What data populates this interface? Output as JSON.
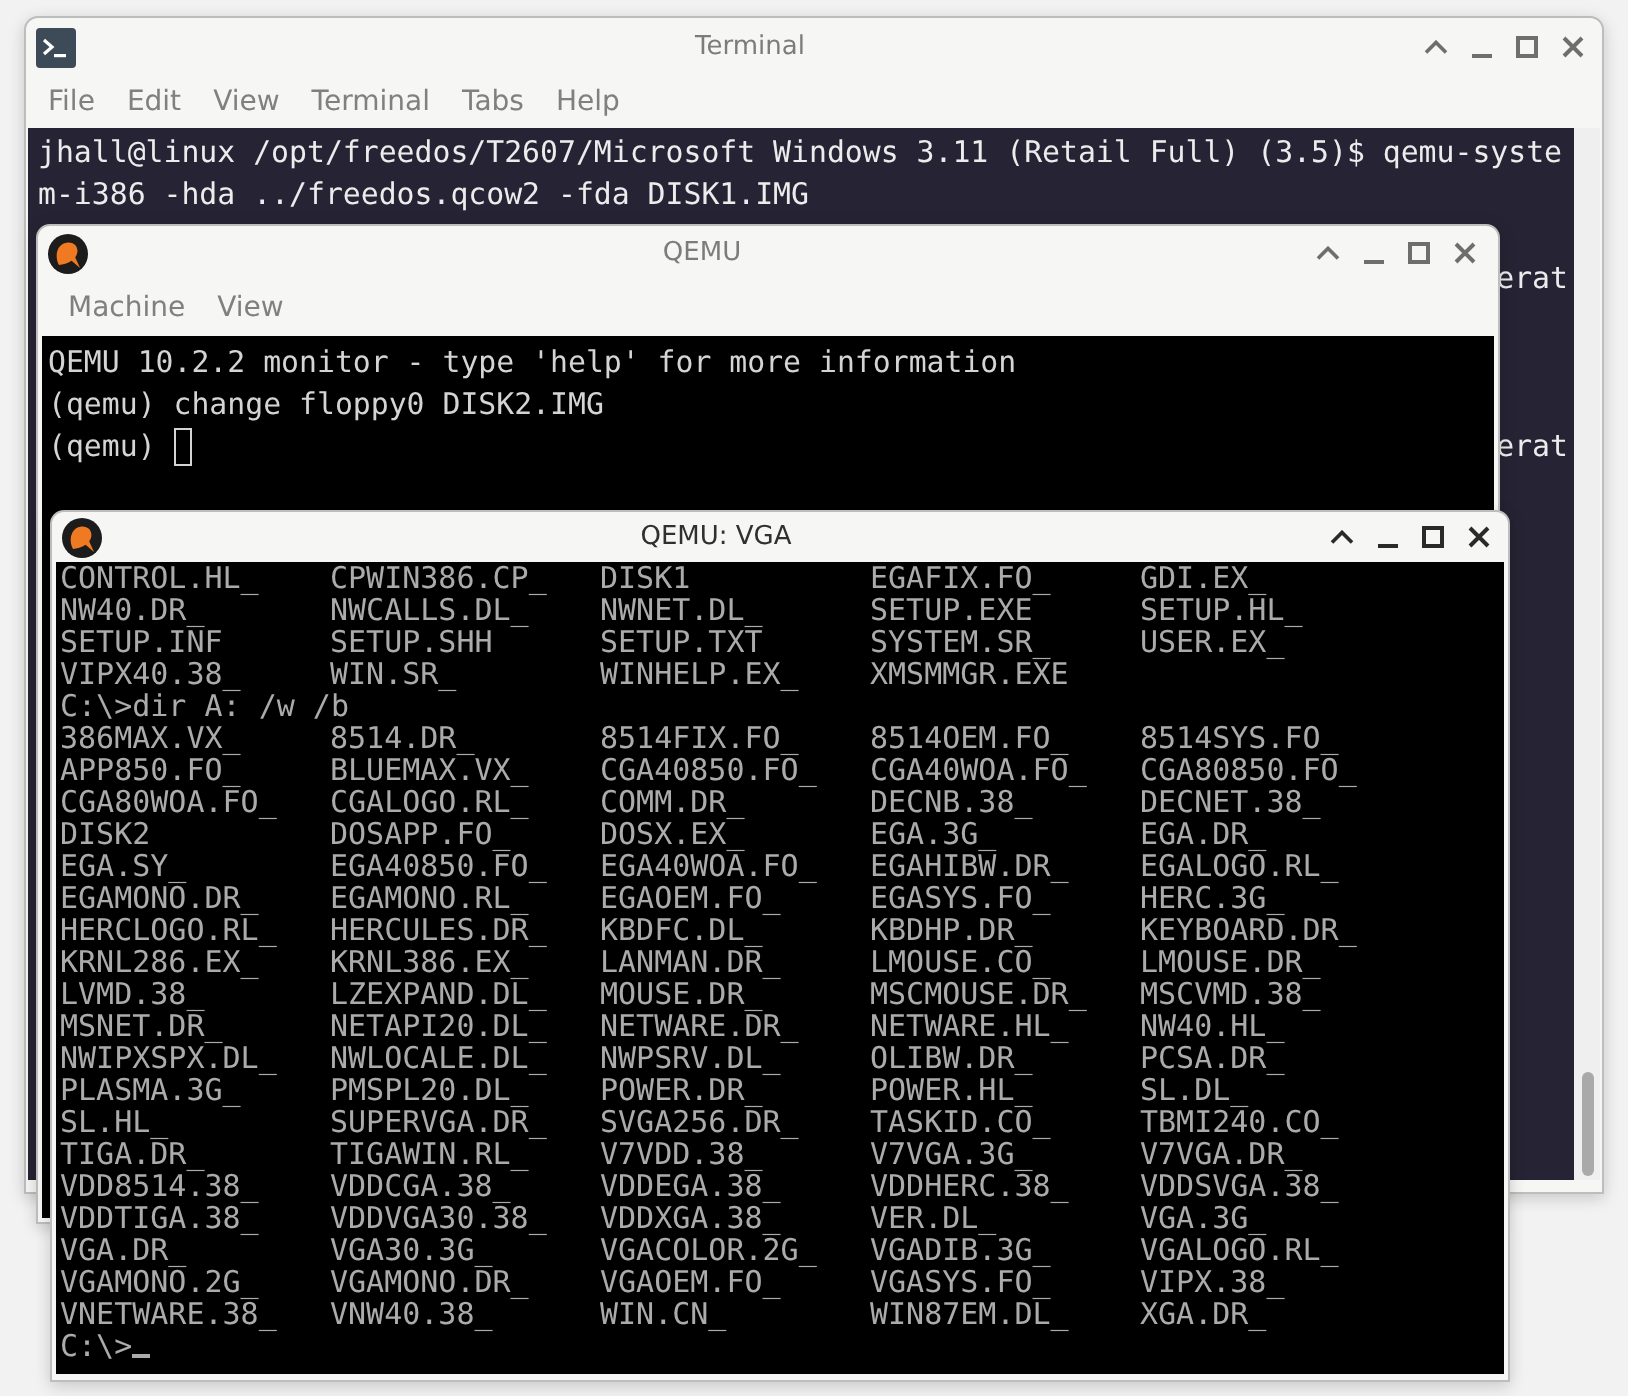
{
  "terminal": {
    "title": "Terminal",
    "active": false,
    "menu": [
      "File",
      "Edit",
      "View",
      "Terminal",
      "Tabs",
      "Help"
    ],
    "lines": [
      {
        "kind": "full",
        "text": "jhall@linux /opt/freedos/T2607/Microsoft Windows 3.11 (Retail Full) (3.5)$ qemu-syste"
      },
      {
        "kind": "full",
        "text": "m-i386 -hda ../freedos.qcow2 -fda DISK1.IMG"
      },
      {
        "kind": "cut",
        "text": "erat"
      },
      {
        "kind": "cut",
        "text": "erat"
      }
    ]
  },
  "monitor": {
    "title": "QEMU",
    "active": false,
    "menu": [
      "Machine",
      "View"
    ],
    "lines": [
      {
        "kind": "output",
        "text": "QEMU 10.2.2 monitor - type 'help' for more information"
      },
      {
        "kind": "output",
        "text": "(qemu) change floppy0 DISK2.IMG"
      },
      {
        "kind": "prompt",
        "text": "(qemu)"
      }
    ]
  },
  "vga": {
    "title": "QEMU: VGA",
    "active": true,
    "rows": [
      {
        "kind": "files",
        "files": [
          "CONTROL.HL_",
          "CPWIN386.CP_",
          "DISK1",
          "EGAFIX.FO_",
          "GDI.EX_"
        ]
      },
      {
        "kind": "files",
        "files": [
          "NW40.DR_",
          "NWCALLS.DL_",
          "NWNET.DL_",
          "SETUP.EXE",
          "SETUP.HL_"
        ]
      },
      {
        "kind": "files",
        "files": [
          "SETUP.INF",
          "SETUP.SHH",
          "SETUP.TXT",
          "SYSTEM.SR_",
          "USER.EX_"
        ]
      },
      {
        "kind": "files",
        "files": [
          "VIPX40.38_",
          "WIN.SR_",
          "WINHELP.EX_",
          "XMSMMGR.EXE"
        ]
      },
      {
        "kind": "command",
        "text": "C:\\>dir A: /w /b"
      },
      {
        "kind": "files",
        "files": [
          "386MAX.VX_",
          "8514.DR_",
          "8514FIX.FO_",
          "8514OEM.FO_",
          "8514SYS.FO_"
        ]
      },
      {
        "kind": "files",
        "files": [
          "APP850.FO_",
          "BLUEMAX.VX_",
          "CGA40850.FO_",
          "CGA40WOA.FO_",
          "CGA80850.FO_"
        ]
      },
      {
        "kind": "files",
        "files": [
          "CGA80WOA.FO_",
          "CGALOGO.RL_",
          "COMM.DR_",
          "DECNB.38_",
          "DECNET.38_"
        ]
      },
      {
        "kind": "files",
        "files": [
          "DISK2",
          "DOSAPP.FO_",
          "DOSX.EX_",
          "EGA.3G_",
          "EGA.DR_"
        ]
      },
      {
        "kind": "files",
        "files": [
          "EGA.SY_",
          "EGA40850.FO_",
          "EGA40WOA.FO_",
          "EGAHIBW.DR_",
          "EGALOGO.RL_"
        ]
      },
      {
        "kind": "files",
        "files": [
          "EGAMONO.DR_",
          "EGAMONO.RL_",
          "EGAOEM.FO_",
          "EGASYS.FO_",
          "HERC.3G_"
        ]
      },
      {
        "kind": "files",
        "files": [
          "HERCLOGO.RL_",
          "HERCULES.DR_",
          "KBDFC.DL_",
          "KBDHP.DR_",
          "KEYBOARD.DR_"
        ]
      },
      {
        "kind": "files",
        "files": [
          "KRNL286.EX_",
          "KRNL386.EX_",
          "LANMAN.DR_",
          "LMOUSE.CO_",
          "LMOUSE.DR_"
        ]
      },
      {
        "kind": "files",
        "files": [
          "LVMD.38_",
          "LZEXPAND.DL_",
          "MOUSE.DR_",
          "MSCMOUSE.DR_",
          "MSCVMD.38_"
        ]
      },
      {
        "kind": "files",
        "files": [
          "MSNET.DR_",
          "NETAPI20.DL_",
          "NETWARE.DR_",
          "NETWARE.HL_",
          "NW40.HL_"
        ]
      },
      {
        "kind": "files",
        "files": [
          "NWIPXSPX.DL_",
          "NWLOCALE.DL_",
          "NWPSRV.DL_",
          "OLIBW.DR_",
          "PCSA.DR_"
        ]
      },
      {
        "kind": "files",
        "files": [
          "PLASMA.3G_",
          "PMSPL20.DL_",
          "POWER.DR_",
          "POWER.HL_",
          "SL.DL_"
        ]
      },
      {
        "kind": "files",
        "files": [
          "SL.HL_",
          "SUPERVGA.DR_",
          "SVGA256.DR_",
          "TASKID.CO_",
          "TBMI240.CO_"
        ]
      },
      {
        "kind": "files",
        "files": [
          "TIGA.DR_",
          "TIGAWIN.RL_",
          "V7VDD.38_",
          "V7VGA.3G_",
          "V7VGA.DR_"
        ]
      },
      {
        "kind": "files",
        "files": [
          "VDD8514.38_",
          "VDDCGA.38_",
          "VDDEGA.38_",
          "VDDHERC.38_",
          "VDDSVGA.38_"
        ]
      },
      {
        "kind": "files",
        "files": [
          "VDDTIGA.38_",
          "VDDVGA30.38_",
          "VDDXGA.38_",
          "VER.DL_",
          "VGA.3G_"
        ]
      },
      {
        "kind": "files",
        "files": [
          "VGA.DR_",
          "VGA30.3G_",
          "VGACOLOR.2G_",
          "VGADIB.3G_",
          "VGALOGO.RL_"
        ]
      },
      {
        "kind": "files",
        "files": [
          "VGAMONO.2G_",
          "VGAMONO.DR_",
          "VGAOEM.FO_",
          "VGASYS.FO_",
          "VIPX.38_"
        ]
      },
      {
        "kind": "files",
        "files": [
          "VNETWARE.38_",
          "VNW40.38_",
          "WIN.CN_",
          "WIN87EM.DL_",
          "XGA.DR_"
        ]
      },
      {
        "kind": "prompt",
        "text": "C:\\>"
      }
    ]
  }
}
